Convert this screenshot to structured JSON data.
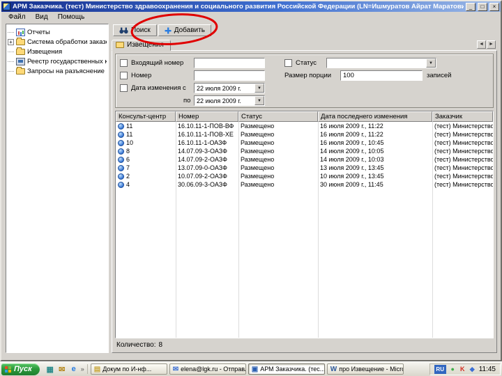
{
  "icons": {
    "minimize": "_",
    "maximize": "□",
    "close": "×",
    "dropdown": "▼",
    "tab_prev": "◄",
    "tab_next": "►",
    "chevron": "»",
    "expand": "+"
  },
  "window": {
    "title": "АРМ Заказчика. (тест) Министерство здравоохранения и социального развития Российской Федерации (LN=Ишмуратов Айрат Маратович, UU=главный специал..."
  },
  "menu": {
    "items": [
      {
        "id": "file",
        "label": "Файл"
      },
      {
        "id": "view",
        "label": "Вид"
      },
      {
        "id": "help",
        "label": "Помощь"
      }
    ]
  },
  "tree": {
    "items": [
      {
        "id": "reports",
        "label": "Отчеты",
        "icon": "report",
        "expandable": false
      },
      {
        "id": "orders",
        "label": "Система обработки заказов",
        "icon": "folder",
        "expandable": true
      },
      {
        "id": "notices",
        "label": "Извещения",
        "icon": "folder",
        "expandable": false
      },
      {
        "id": "registry",
        "label": "Реестр государственных контрактов",
        "icon": "computer",
        "expandable": false
      },
      {
        "id": "requests",
        "label": "Запросы на разъяснение",
        "icon": "folder",
        "expandable": false
      }
    ]
  },
  "toolbar": {
    "search_label": "Поиск",
    "add_label": "Добавить"
  },
  "tab": {
    "label": "Извещения"
  },
  "filters": {
    "incoming_label": "Входящий номер",
    "number_label": "Номер",
    "date_label": "Дата изменения с",
    "date_from": "22  июля  2009 г.",
    "to_label": "по",
    "date_to": "22  июля  2009 г.",
    "status_label": "Статус",
    "status_value": "",
    "portion_label": "Размер порции",
    "portion_value": "100",
    "portion_suffix": "записей"
  },
  "table": {
    "columns": [
      "Консульт-центр",
      "Номер",
      "Статус",
      "Дата последнего изменения",
      "Заказчик"
    ],
    "rows": [
      [
        "11",
        "16.10.11-1-ПОВ-ВФ",
        "Размещено",
        "16 июля 2009 г., 11:22",
        "(тест) Министерство здраво"
      ],
      [
        "11",
        "16.10.11-1-ПОВ-ХЕ",
        "Размещено",
        "16 июля 2009 г., 11:22",
        "(тест) Министерство здраво"
      ],
      [
        "10",
        "16.10.11-1-ОАЗФ",
        "Размещено",
        "16 июля 2009 г., 10:45",
        "(тест) Министерство здраво"
      ],
      [
        "8",
        "14.07.09-3-ОАЗФ",
        "Размещено",
        "14 июля 2009 г., 10:05",
        "(тест) Министерство здраво"
      ],
      [
        "6",
        "14.07.09-2-ОАЗФ",
        "Размещено",
        "14 июля 2009 г., 10:03",
        "(тест) Министерство здраво"
      ],
      [
        "7",
        "13.07.09-0-ОАЗФ",
        "Размещено",
        "13 июля 2009 г., 13:45",
        "(тест) Министерство здраво"
      ],
      [
        "2",
        "10.07.09-2-ОАЗФ",
        "Размещено",
        "10 июля 2009 г., 13:45",
        "(тест) Министерство здраво"
      ],
      [
        "4",
        "30.06.09-3-ОАЗФ",
        "Размещено",
        "30 июня 2009 г., 11:45",
        "(тест) Министерство здраво"
      ]
    ],
    "count_label": "Количество:",
    "count_value": "8"
  },
  "taskbar": {
    "start_label": "Пуск",
    "quicklaunch": [
      {
        "id": "browser",
        "glyph": "e",
        "color": "#2a7de1"
      },
      {
        "id": "mail",
        "glyph": "✉",
        "color": "#b58618"
      },
      {
        "id": "desktop",
        "glyph": "▦",
        "color": "#2c8c8c"
      }
    ],
    "tasks": [
      {
        "id": "docs",
        "label": "Докум по И-нф...",
        "glyph": "▤",
        "color": "#caa93e",
        "active": false
      },
      {
        "id": "mail",
        "label": "elena@lgk.ru - Отправлен...",
        "glyph": "✉",
        "color": "#3b6fd4",
        "active": false
      },
      {
        "id": "arm",
        "label": "АРМ Заказчика. (тес...",
        "glyph": "▣",
        "color": "#2c5fb0",
        "active": true
      },
      {
        "id": "word",
        "label": "про Извещение - Micros...",
        "glyph": "W",
        "color": "#2b579a",
        "active": false
      }
    ],
    "tray": {
      "lang": "RU",
      "icons": [
        {
          "id": "status",
          "glyph": "●",
          "color": "#3fae49"
        },
        {
          "id": "antivirus",
          "glyph": "K",
          "color": "#d42b1e"
        },
        {
          "id": "network",
          "glyph": "◆",
          "color": "#3b6fd4"
        }
      ],
      "clock": "11:45"
    }
  },
  "annotation": {
    "color": "#e00000"
  }
}
